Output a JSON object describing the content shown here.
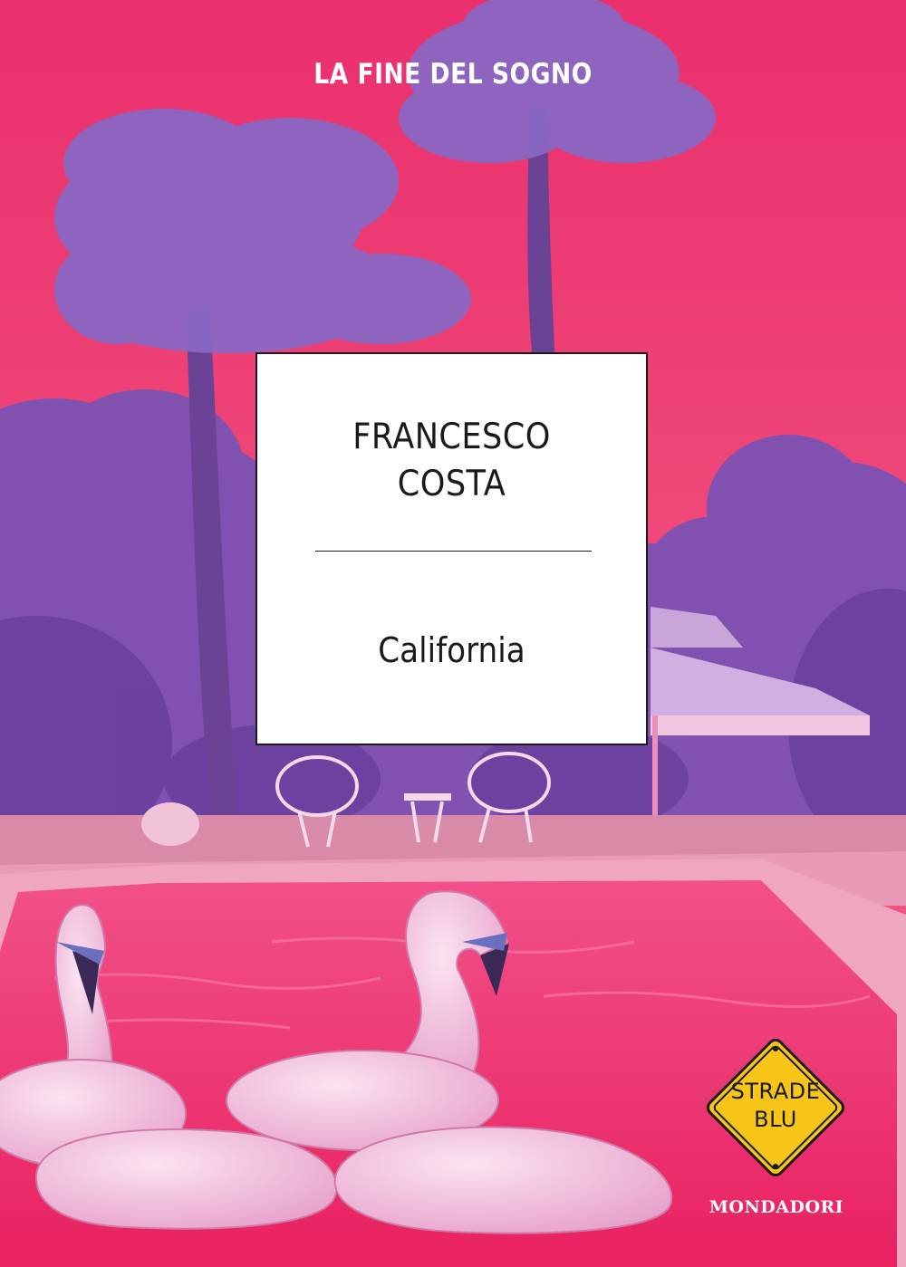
{
  "cover": {
    "series_title": "LA FINE DEL SOGNO",
    "author_line1": "FRANCESCO",
    "author_line2": "COSTA",
    "book_title": "California",
    "collection_line1": "STRADE",
    "collection_line2": "BLU",
    "publisher": "MONDADORI"
  },
  "colors": {
    "sky": "#ee3d72",
    "foliage": "#7a4fb0",
    "pool": "#f0336f",
    "badge": "#f7c418",
    "box": "#ffffff"
  }
}
